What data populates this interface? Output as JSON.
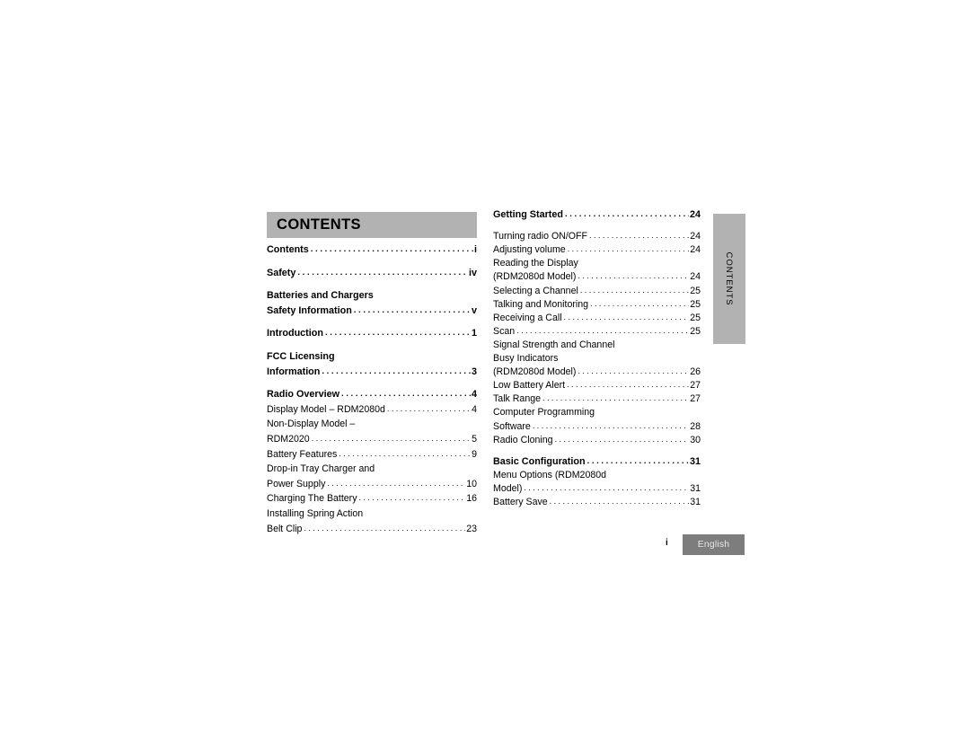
{
  "document": {
    "heading": "CONTENTS",
    "side_tab_label": "CONTENTS",
    "page_number": "i",
    "language_badge": "English",
    "colors": {
      "header_bar": "#b2b2b2",
      "side_tab": "#b2b2b2",
      "language_badge": "#7d7d7d",
      "language_badge_text": "#e8e8e8",
      "text": "#000000",
      "page_background": "#ffffff"
    }
  },
  "toc": {
    "left_column": [
      {
        "label": "Contents",
        "page": "i",
        "bold": true,
        "leaders": true
      },
      {
        "label": "Safety",
        "page": "iv",
        "bold": true,
        "leaders": true
      },
      {
        "label": "Batteries and Chargers",
        "page": "",
        "bold": true,
        "leaders": false
      },
      {
        "label": "Safety Information",
        "page": "v",
        "bold": true,
        "leaders": true
      },
      {
        "label": "Introduction",
        "page": "1",
        "bold": true,
        "leaders": true
      },
      {
        "label": "FCC Licensing",
        "page": "",
        "bold": true,
        "leaders": false
      },
      {
        "label": "Information",
        "page": "3",
        "bold": true,
        "leaders": true
      },
      {
        "label": "Radio Overview",
        "page": "4",
        "bold": true,
        "leaders": true
      },
      {
        "label": "Display Model – RDM2080d",
        "page": "4",
        "bold": false,
        "leaders": true
      },
      {
        "label": "Non-Display Model –",
        "page": "",
        "bold": false,
        "leaders": false
      },
      {
        "label": "RDM2020",
        "page": "5",
        "bold": false,
        "leaders": true
      },
      {
        "label": "Battery Features",
        "page": "9",
        "bold": false,
        "leaders": true
      },
      {
        "label": "Drop-in Tray Charger and",
        "page": "",
        "bold": false,
        "leaders": false
      },
      {
        "label": "Power Supply",
        "page": "10",
        "bold": false,
        "leaders": true
      },
      {
        "label": "Charging The Battery",
        "page": "16",
        "bold": false,
        "leaders": true
      },
      {
        "label": "Installing Spring Action",
        "page": "",
        "bold": false,
        "leaders": false
      },
      {
        "label": "Belt Clip",
        "page": "23",
        "bold": false,
        "leaders": true
      }
    ],
    "right_column": [
      {
        "label": "Getting Started",
        "page": "24",
        "bold": true,
        "leaders": true
      },
      {
        "label": "Turning radio ON/OFF",
        "page": "24",
        "bold": false,
        "leaders": true
      },
      {
        "label": "Adjusting volume",
        "page": "24",
        "bold": false,
        "leaders": true
      },
      {
        "label": "Reading the Display",
        "page": "",
        "bold": false,
        "leaders": false
      },
      {
        "label": "(RDM2080d Model)",
        "page": "24",
        "bold": false,
        "leaders": true
      },
      {
        "label": "Selecting a Channel",
        "page": "25",
        "bold": false,
        "leaders": true
      },
      {
        "label": "Talking and Monitoring",
        "page": "25",
        "bold": false,
        "leaders": true
      },
      {
        "label": "Receiving a Call",
        "page": "25",
        "bold": false,
        "leaders": true
      },
      {
        "label": "Scan",
        "page": "25",
        "bold": false,
        "leaders": true
      },
      {
        "label": "Signal Strength and Channel",
        "page": "",
        "bold": false,
        "leaders": false
      },
      {
        "label": "Busy Indicators",
        "page": "",
        "bold": false,
        "leaders": false
      },
      {
        "label": "(RDM2080d Model)",
        "page": "26",
        "bold": false,
        "leaders": true
      },
      {
        "label": "Low Battery Alert",
        "page": "27",
        "bold": false,
        "leaders": true
      },
      {
        "label": "Talk Range",
        "page": "27",
        "bold": false,
        "leaders": true
      },
      {
        "label": "Computer Programming",
        "page": "",
        "bold": false,
        "leaders": false
      },
      {
        "label": "Software",
        "page": "28",
        "bold": false,
        "leaders": true
      },
      {
        "label": "Radio Cloning",
        "page": "30",
        "bold": false,
        "leaders": true
      },
      {
        "label": "Basic Configuration",
        "page": "31",
        "bold": true,
        "leaders": true
      },
      {
        "label": "Menu Options (RDM2080d",
        "page": "",
        "bold": false,
        "leaders": false
      },
      {
        "label": "Model)",
        "page": "31",
        "bold": false,
        "leaders": true
      },
      {
        "label": "Battery Save",
        "page": "31",
        "bold": false,
        "leaders": true
      }
    ],
    "left_column_gaps_after": [
      0,
      1,
      3,
      4,
      6
    ],
    "right_column_gaps_after": [
      0,
      16
    ]
  }
}
